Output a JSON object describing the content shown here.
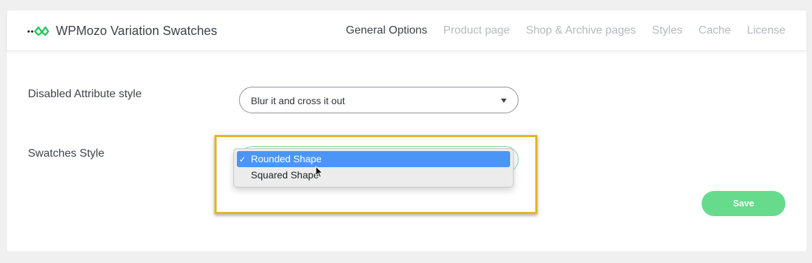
{
  "header": {
    "app_title": "WPMozo Variation Swatches",
    "logo_icon": "wpmozo-logo-icon",
    "brand_color": "#22c55e",
    "nav": [
      {
        "label": "General Options",
        "active": true
      },
      {
        "label": "Product page",
        "active": false
      },
      {
        "label": "Shop & Archive pages",
        "active": false
      },
      {
        "label": "Styles",
        "active": false
      },
      {
        "label": "Cache",
        "active": false
      },
      {
        "label": "License",
        "active": false
      }
    ]
  },
  "settings": {
    "disabled_attribute_style": {
      "label": "Disabled Attribute style",
      "value": "Blur it and cross it out"
    },
    "swatches_style": {
      "label": "Swatches Style",
      "options": [
        {
          "label": "Rounded Shape",
          "selected": true
        },
        {
          "label": "Squared Shape",
          "selected": false
        }
      ],
      "checkmark": "✓"
    }
  },
  "save_label": "Save",
  "colors": {
    "accent_green": "#66db8c",
    "highlight_border": "#e3b520",
    "selection_blue": "#4a96f7"
  }
}
